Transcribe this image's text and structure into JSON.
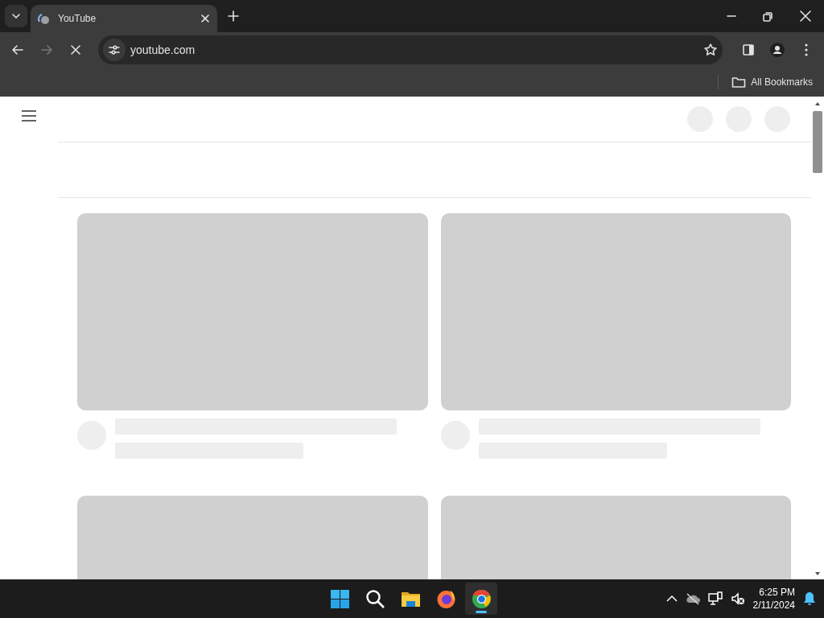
{
  "browser": {
    "tabs": [
      {
        "title": "YouTube",
        "selected": true,
        "loading": true
      }
    ],
    "toolbar": {
      "back_disabled": false,
      "forward_disabled": true,
      "loading": true,
      "url": "youtube.com"
    },
    "bookmarks_bar": {
      "label": "All Bookmarks"
    }
  },
  "page": {
    "header_placeholders": [
      {
        "kind": "circle"
      },
      {
        "kind": "circle"
      },
      {
        "kind": "circle"
      }
    ],
    "video_placeholders": [
      {
        "kind": "video"
      },
      {
        "kind": "video"
      },
      {
        "kind": "thumbnail"
      },
      {
        "kind": "thumbnail"
      }
    ]
  },
  "taskbar": {
    "apps": [
      {
        "kind": "start",
        "selected": false
      },
      {
        "kind": "search",
        "selected": false
      },
      {
        "kind": "files",
        "selected": false
      },
      {
        "kind": "firefox",
        "selected": false
      },
      {
        "kind": "chrome",
        "selected": true
      }
    ],
    "clock": {
      "time": "6:25 PM",
      "date": "2/11/2024"
    }
  }
}
